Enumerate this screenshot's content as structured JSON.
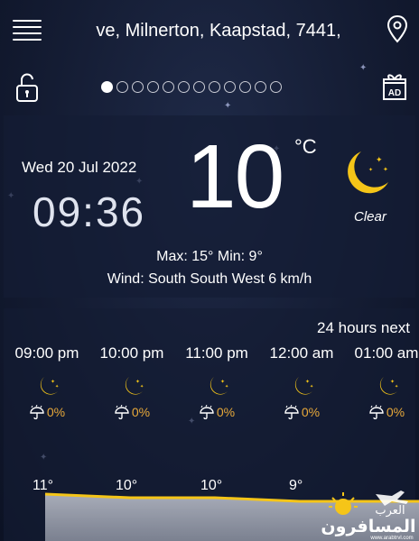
{
  "header": {
    "location": "ve, Milnerton, Kaapstad, 7441,",
    "menu_icon": "hamburger-menu-icon",
    "pin_icon": "location-pin-icon",
    "lock_icon": "unlocked-padlock-icon",
    "ad_icon": "gift-ad-icon",
    "page_count": 12,
    "active_page": 1
  },
  "current": {
    "date": "Wed 20 Jul 2022",
    "time": "09:36",
    "temperature": "10",
    "unit": "°C",
    "condition": "Clear",
    "condition_icon": "crescent-moon-icon",
    "max_min": "Max: 15°  Min: 9°",
    "wind": "Wind: South South West 6 km/h"
  },
  "hourly": {
    "title": "24 hours next",
    "hours": [
      {
        "time": "09:00 pm",
        "precip": "0%"
      },
      {
        "time": "10:00 pm",
        "precip": "0%"
      },
      {
        "time": "11:00 pm",
        "precip": "0%"
      },
      {
        "time": "12:00 am",
        "precip": "0%"
      },
      {
        "time": "01:00 am",
        "precip": "0%"
      }
    ],
    "temps": [
      "11°",
      "10°",
      "10°",
      "9°"
    ],
    "temps_numeric": [
      11,
      10,
      10,
      9
    ]
  },
  "watermark": {
    "arabic_top": "العرب",
    "arabic_main": "المسافرون",
    "site": "www.arabtrvl.com"
  },
  "colors": {
    "accent_yellow": "#f5c518",
    "precip_orange": "#e8a93a"
  }
}
